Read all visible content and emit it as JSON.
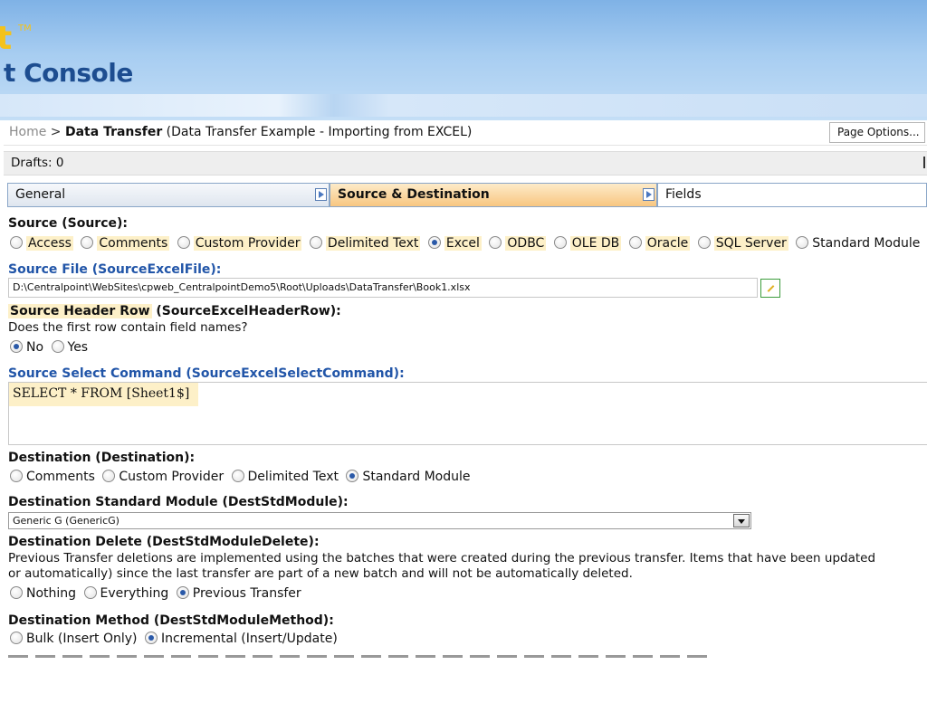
{
  "header": {
    "brand_fragment": "t",
    "trademark": "TM",
    "console_fragment": "t Console"
  },
  "breadcrumb": {
    "home": "Home",
    "separator": " > ",
    "current": "Data Transfer",
    "context": " (Data Transfer Example - Importing from EXCEL)"
  },
  "page_options_label": "Page Options...",
  "drafts_label": "Drafts: 0",
  "tabs": [
    {
      "label": "General",
      "active": false
    },
    {
      "label": "Source & Destination",
      "active": true
    },
    {
      "label": "Fields",
      "active": false
    }
  ],
  "source": {
    "label": "Source (Source):",
    "options": [
      "Access",
      "Comments",
      "Custom Provider",
      "Delimited Text",
      "Excel",
      "ODBC",
      "OLE DB",
      "Oracle",
      "SQL Server",
      "Standard Module"
    ],
    "selected": "Excel"
  },
  "source_file": {
    "label": "Source File (SourceExcelFile):",
    "value": "D:\\Centralpoint\\WebSites\\cpweb_CentralpointDemo5\\Root\\Uploads\\DataTransfer\\Book1.xlsx"
  },
  "source_header_row": {
    "label_highlight": "Source Header Row",
    "label_rest": " (SourceExcelHeaderRow):",
    "question": "Does the first row contain field names?",
    "options": [
      "No",
      "Yes"
    ],
    "selected": "No"
  },
  "source_select_command": {
    "label": "Source Select Command (SourceExcelSelectCommand):",
    "value": "SELECT * FROM [Sheet1$]"
  },
  "destination": {
    "label": "Destination (Destination):",
    "options": [
      "Comments",
      "Custom Provider",
      "Delimited Text",
      "Standard Module"
    ],
    "selected": "Standard Module"
  },
  "dest_std_module": {
    "label": "Destination Standard Module (DestStdModule):",
    "selected_value": "Generic G (GenericG)"
  },
  "dest_delete": {
    "label": "Destination Delete (DestStdModuleDelete):",
    "desc_line1": "Previous Transfer deletions are implemented using the batches that were created during the previous transfer. Items that have been updated",
    "desc_line2": "or automatically) since the last transfer are part of a new batch and will not be automatically deleted.",
    "options": [
      "Nothing",
      "Everything",
      "Previous Transfer"
    ],
    "selected": "Previous Transfer"
  },
  "dest_method": {
    "label": "Destination Method (DestStdModuleMethod):",
    "options": [
      "Bulk (Insert Only)",
      "Incremental (Insert/Update)"
    ],
    "selected": "Incremental (Insert/Update)"
  }
}
